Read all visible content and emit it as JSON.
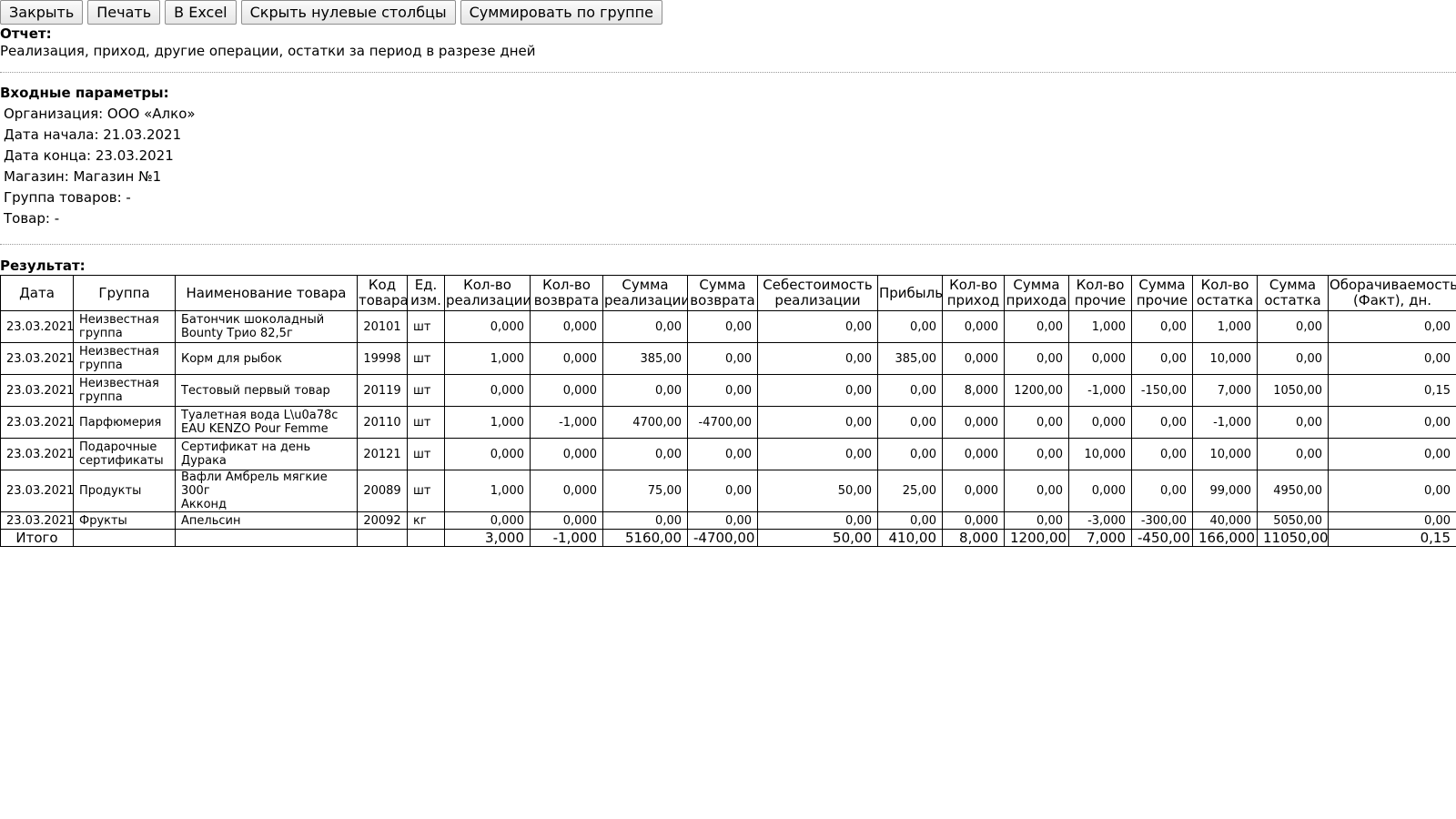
{
  "toolbar": {
    "close": "Закрыть",
    "print": "Печать",
    "excel": "В Excel",
    "hide_zero": "Скрыть нулевые столбцы",
    "sum_group": "Суммировать по группе"
  },
  "report": {
    "label": "Отчет:",
    "title": "Реализация, приход, другие операции, остатки за период в разрезе дней"
  },
  "params": {
    "label": "Входные параметры:",
    "org": "Организация: ООО «Алко»",
    "start": "Дата начала: 21.03.2021",
    "end": "Дата конца: 23.03.2021",
    "shop": "Магазин: Магазин №1",
    "group": "Группа товаров: -",
    "product": "Товар: -"
  },
  "result_label": "Результат:",
  "table": {
    "headers": [
      [
        "Дата"
      ],
      [
        "Группа"
      ],
      [
        "Наименование товара"
      ],
      [
        "Код",
        "товара"
      ],
      [
        "Ед.",
        "изм."
      ],
      [
        "Кол-во",
        "реализации"
      ],
      [
        "Кол-во",
        "возврата"
      ],
      [
        "Сумма",
        "реализации"
      ],
      [
        "Сумма",
        "возврата"
      ],
      [
        "Себестоимость",
        "реализации"
      ],
      [
        "Прибыль"
      ],
      [
        "Кол-во",
        "приход"
      ],
      [
        "Сумма",
        "прихода"
      ],
      [
        "Кол-во",
        "прочие"
      ],
      [
        "Сумма",
        "прочие"
      ],
      [
        "Кол-во",
        "остатка"
      ],
      [
        "Сумма",
        "остатка"
      ],
      [
        "Оборачиваемость",
        "(Факт), дн."
      ]
    ],
    "rows": [
      {
        "date": "23.03.2021",
        "group": [
          "Неизвестная",
          "группа"
        ],
        "name": [
          "Батончик шоколадный",
          "Bounty Трио 82,5г"
        ],
        "code": "20101",
        "unit": "шт",
        "qty_sale": "0,000",
        "qty_ret": "0,000",
        "sum_sale": "0,00",
        "sum_ret": "0,00",
        "cost": "0,00",
        "profit": "0,00",
        "qty_in": "0,000",
        "sum_in": "0,00",
        "qty_other": "1,000",
        "sum_other": "0,00",
        "qty_rest": "1,000",
        "sum_rest": "0,00",
        "turnover": "0,00"
      },
      {
        "date": "23.03.2021",
        "group": [
          "Неизвестная",
          "группа"
        ],
        "name": [
          "Корм для рыбок"
        ],
        "code": "19998",
        "unit": "шт",
        "qty_sale": "1,000",
        "qty_ret": "0,000",
        "sum_sale": "385,00",
        "sum_ret": "0,00",
        "cost": "0,00",
        "profit": "385,00",
        "qty_in": "0,000",
        "sum_in": "0,00",
        "qty_other": "0,000",
        "sum_other": "0,00",
        "qty_rest": "10,000",
        "sum_rest": "0,00",
        "turnover": "0,00"
      },
      {
        "date": "23.03.2021",
        "group": [
          "Неизвестная",
          "группа"
        ],
        "name": [
          "Тестовый первый товар"
        ],
        "code": "20119",
        "unit": "шт",
        "qty_sale": "0,000",
        "qty_ret": "0,000",
        "sum_sale": "0,00",
        "sum_ret": "0,00",
        "cost": "0,00",
        "profit": "0,00",
        "qty_in": "8,000",
        "sum_in": "1200,00",
        "qty_other": "-1,000",
        "sum_other": "-150,00",
        "qty_rest": "7,000",
        "sum_rest": "1050,00",
        "turnover": "0,15"
      },
      {
        "date": "23.03.2021",
        "group": [
          "Парфюмерия"
        ],
        "name": [
          "Туалетная вода L\\u0a78c",
          "EAU KENZO Pour Femme"
        ],
        "code": "20110",
        "unit": "шт",
        "qty_sale": "1,000",
        "qty_ret": "-1,000",
        "sum_sale": "4700,00",
        "sum_ret": "-4700,00",
        "cost": "0,00",
        "profit": "0,00",
        "qty_in": "0,000",
        "sum_in": "0,00",
        "qty_other": "0,000",
        "sum_other": "0,00",
        "qty_rest": "-1,000",
        "sum_rest": "0,00",
        "turnover": "0,00"
      },
      {
        "date": "23.03.2021",
        "group": [
          "Подарочные",
          "сертификаты"
        ],
        "name": [
          "Сертификат на день Дурака"
        ],
        "code": "20121",
        "unit": "шт",
        "qty_sale": "0,000",
        "qty_ret": "0,000",
        "sum_sale": "0,00",
        "sum_ret": "0,00",
        "cost": "0,00",
        "profit": "0,00",
        "qty_in": "0,000",
        "sum_in": "0,00",
        "qty_other": "10,000",
        "sum_other": "0,00",
        "qty_rest": "10,000",
        "sum_rest": "0,00",
        "turnover": "0,00"
      },
      {
        "date": "23.03.2021",
        "group": [
          "Продукты"
        ],
        "name": [
          "Вафли Амбрель мягкие 300г",
          "Акконд"
        ],
        "code": "20089",
        "unit": "шт",
        "qty_sale": "1,000",
        "qty_ret": "0,000",
        "sum_sale": "75,00",
        "sum_ret": "0,00",
        "cost": "50,00",
        "profit": "25,00",
        "qty_in": "0,000",
        "sum_in": "0,00",
        "qty_other": "0,000",
        "sum_other": "0,00",
        "qty_rest": "99,000",
        "sum_rest": "4950,00",
        "turnover": "0,00"
      },
      {
        "date": "23.03.2021",
        "group": [
          "Фрукты"
        ],
        "name": [
          "Апельсин"
        ],
        "code": "20092",
        "unit": "кг",
        "qty_sale": "0,000",
        "qty_ret": "0,000",
        "sum_sale": "0,00",
        "sum_ret": "0,00",
        "cost": "0,00",
        "profit": "0,00",
        "qty_in": "0,000",
        "sum_in": "0,00",
        "qty_other": "-3,000",
        "sum_other": "-300,00",
        "qty_rest": "40,000",
        "sum_rest": "5050,00",
        "turnover": "0,00"
      }
    ],
    "total": {
      "label": "Итого",
      "group": "",
      "name": "",
      "code": "",
      "unit": "",
      "qty_sale": "3,000",
      "qty_ret": "-1,000",
      "sum_sale": "5160,00",
      "sum_ret": "-4700,00",
      "cost": "50,00",
      "profit": "410,00",
      "qty_in": "8,000",
      "sum_in": "1200,00",
      "qty_other": "7,000",
      "sum_other": "-450,00",
      "qty_rest": "166,000",
      "sum_rest": "11050,00",
      "turnover": "0,15"
    }
  }
}
